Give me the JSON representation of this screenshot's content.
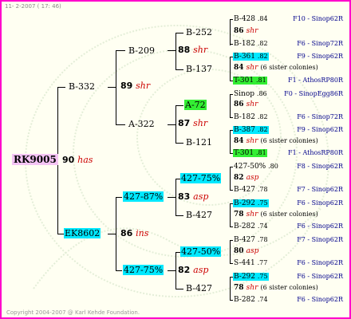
{
  "header": "11- 2-2007 ( 17: 46)",
  "footer": "Copyright 2004-2007 @ Karl Kehde Foundation.",
  "root": {
    "name": "RK9005",
    "score": "90",
    "trait": "has"
  },
  "gen1": [
    {
      "name": "B-332",
      "score": "89",
      "trait": "shr"
    },
    {
      "name": "EK8602",
      "score": "86",
      "trait": "ins"
    }
  ],
  "gen2": [
    {
      "name": "B-209",
      "score": "88",
      "trait": "shr"
    },
    {
      "name": "A-322",
      "score": "87",
      "trait": "shr"
    },
    {
      "name": "427-87%",
      "score": "83",
      "trait": "asp"
    },
    {
      "name": "427-75%",
      "score": "82",
      "trait": "asp"
    }
  ],
  "gen3": [
    {
      "name": "B-252",
      "score": "86",
      "trait": "shr"
    },
    {
      "name": "B-137",
      "score": "84",
      "trait": "shr",
      "extra": "(6 sister colonies)"
    },
    {
      "name": "A-72",
      "score": "86",
      "trait": "shr"
    },
    {
      "name": "B-121",
      "score": "84",
      "trait": "shr",
      "extra": "(6 sister colonies)"
    },
    {
      "name": "427-75%",
      "score": "82",
      "trait": "asp"
    },
    {
      "name": "B-427",
      "score": "78",
      "trait": "shr",
      "extra": "(6 sister colonies)"
    },
    {
      "name": "427-50%",
      "score": "80",
      "trait": "asp"
    },
    {
      "name": "B-427",
      "score": "78",
      "trait": "shr",
      "extra": "(6 sister colonies)"
    }
  ],
  "gen4": [
    {
      "name": "B-428",
      "num": ".84",
      "ref": "F10 - Sinop62R"
    },
    {
      "name": "B-182",
      "num": ".82",
      "ref": "F6 - Sinop72R"
    },
    {
      "name": "B-361",
      "num": ".82",
      "ref": "F9 - Sinop62R"
    },
    {
      "name": "T-301",
      "num": ".81",
      "ref": "F1 - AthosRP80R"
    },
    {
      "name": "Sinop",
      "num": ".86",
      "ref": "F0 - SinopEgg86R"
    },
    {
      "name": "B-182",
      "num": ".82",
      "ref": "F6 - Sinop72R"
    },
    {
      "name": "B-387",
      "num": ".82",
      "ref": "F9 - Sinop62R"
    },
    {
      "name": "T-301",
      "num": ".81",
      "ref": "F1 - AthosRP80R"
    },
    {
      "name": "427-50%",
      "num": ".80",
      "ref": "F8 - Sinop62R"
    },
    {
      "name": "B-427",
      "num": ".78",
      "ref": "F7 - Sinop62R"
    },
    {
      "name": "B-292",
      "num": ".75",
      "ref": "F6 - Sinop62R"
    },
    {
      "name": "B-282",
      "num": ".74",
      "ref": "F6 - Sinop62R"
    },
    {
      "name": "B-427",
      "num": ".78",
      "ref": "F7 - Sinop62R"
    },
    {
      "name": "S-441",
      "num": ".77",
      "ref": "F6 - Sinop62R"
    },
    {
      "name": "B-292",
      "num": ".75",
      "ref": "F6 - Sinop62R"
    },
    {
      "name": "B-282",
      "num": ".74",
      "ref": "F6 - Sinop62R"
    }
  ],
  "colors": {
    "frame": "#ff00cc",
    "highlight_cyan": "#00e8ff",
    "highlight_green": "#33ee33",
    "trait": "#cc0000",
    "ref": "#00008b"
  }
}
